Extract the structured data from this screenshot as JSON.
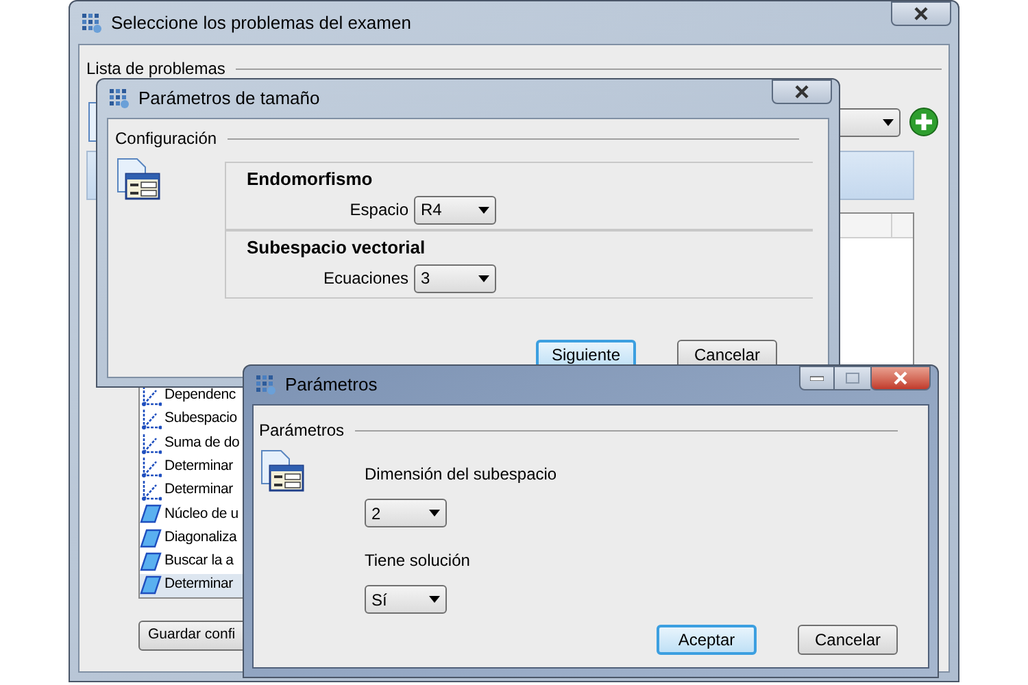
{
  "main_window": {
    "title": "Seleccione los problemas del examen",
    "group_label": "Lista de problemas",
    "problems": [
      {
        "kind": "subspace",
        "label": "Dependenc",
        "selected": false
      },
      {
        "kind": "subspace",
        "label": "Subespacio",
        "selected": false
      },
      {
        "kind": "subspace",
        "label": "Suma de do",
        "selected": false
      },
      {
        "kind": "subspace",
        "label": "Determinar",
        "selected": false
      },
      {
        "kind": "subspace",
        "label": "Determinar",
        "selected": false
      },
      {
        "kind": "map",
        "label": "Núcleo de u",
        "selected": false
      },
      {
        "kind": "map",
        "label": "Diagonaliza",
        "selected": false
      },
      {
        "kind": "map",
        "label": "Buscar la a",
        "selected": false
      },
      {
        "kind": "map",
        "label": "Determinar",
        "selected": true
      }
    ],
    "save_button": "Guardar confi"
  },
  "size_dialog": {
    "title": "Parámetros de tamaño",
    "group_label": "Configuración",
    "sections": [
      {
        "heading": "Endomorfismo",
        "field_label": "Espacio",
        "value": "R4"
      },
      {
        "heading": "Subespacio vectorial",
        "field_label": "Ecuaciones",
        "value": "3"
      }
    ],
    "buttons": [
      {
        "label": "Siguiente",
        "default": true
      },
      {
        "label": "Cancelar",
        "default": false
      }
    ]
  },
  "params_dialog": {
    "title": "Parámetros",
    "group_label": "Parámetros",
    "fields": [
      {
        "label": "Dimensión del subespacio",
        "value": "2"
      },
      {
        "label": "Tiene solución",
        "value": "Sí"
      }
    ],
    "buttons": [
      {
        "label": "Aceptar",
        "default": true
      },
      {
        "label": "Cancelar",
        "default": false
      }
    ]
  }
}
